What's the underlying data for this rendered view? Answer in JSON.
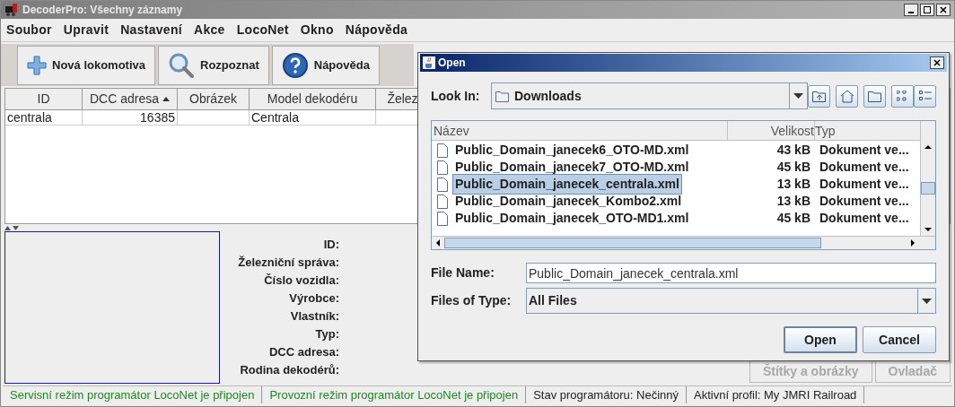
{
  "window": {
    "title": "DecoderPro: Všechny záznamy"
  },
  "menu": [
    "Soubor",
    "Upravit",
    "Nastavení",
    "Akce",
    "LocoNet",
    "Okno",
    "Nápověda"
  ],
  "toolbar": [
    {
      "kind": "add",
      "label": "Nová lokomotiva"
    },
    {
      "kind": "search",
      "label": "Rozpoznat"
    },
    {
      "kind": "help",
      "label": "Nápověda"
    }
  ],
  "table": {
    "columns": [
      {
        "label": "ID",
        "sorted": false
      },
      {
        "label": "DCC adresa",
        "sorted": true
      },
      {
        "label": "Obrázek",
        "sorted": false
      },
      {
        "label": "Model dekodéru",
        "sorted": false
      },
      {
        "label": "Želez",
        "sorted": false
      }
    ],
    "rows": [
      {
        "id": "centrala",
        "dcc_address": "16385",
        "model": "Centrala"
      }
    ]
  },
  "details": [
    "ID:",
    "Železniční správa:",
    "Číslo vozidla:",
    "Výrobce:",
    "Vlastník:",
    "Typ:",
    "DCC adresa:",
    "Rodina dekodérů:"
  ],
  "buttons": [
    {
      "label": "Štítky a obrázky",
      "disabled": true
    },
    {
      "label": "Ovladač",
      "disabled": true
    }
  ],
  "status_bar": [
    {
      "text": "Servisní režim programátor LocoNet je připojen",
      "color": "#1c8a1c"
    },
    {
      "text": "Provozní režim programátor LocoNet je připojen",
      "color": "#1c8a1c"
    },
    {
      "text": "Stav programátoru:  Nečinný",
      "color": "#222222"
    },
    {
      "text": "Aktivní profil: My JMRI Railroad",
      "color": "#222222"
    }
  ],
  "dialog": {
    "title": "Open",
    "look_in": {
      "label": "Look In:",
      "value": "Downloads"
    },
    "columns": [
      "Název",
      "Velikost",
      "Typ"
    ],
    "files": [
      {
        "name": "Public_Domain_janecek6_OTO-MD.xml",
        "size": "43 kB",
        "type": "Dokument ve...",
        "selected": false
      },
      {
        "name": "Public_Domain_janecek7_OTO-MD.xml",
        "size": "45 kB",
        "type": "Dokument ve...",
        "selected": false
      },
      {
        "name": "Public_Domain_janecek_centrala.xml",
        "size": "13 kB",
        "type": "Dokument ve...",
        "selected": true
      },
      {
        "name": "Public_Domain_janecek_Kombo2.xml",
        "size": "13 kB",
        "type": "Dokument ve...",
        "selected": false
      },
      {
        "name": "Public_Domain_janecek_OTO-MD1.xml",
        "size": "45 kB",
        "type": "Dokument ve...",
        "selected": false
      }
    ],
    "file_name": {
      "label": "File Name:",
      "value": "Public_Domain_janecek_centrala.xml"
    },
    "file_type": {
      "label": "Files of Type:",
      "value": "All Files"
    },
    "buttons": [
      {
        "label": "Open",
        "default": true
      },
      {
        "label": "Cancel",
        "default": false
      }
    ]
  }
}
